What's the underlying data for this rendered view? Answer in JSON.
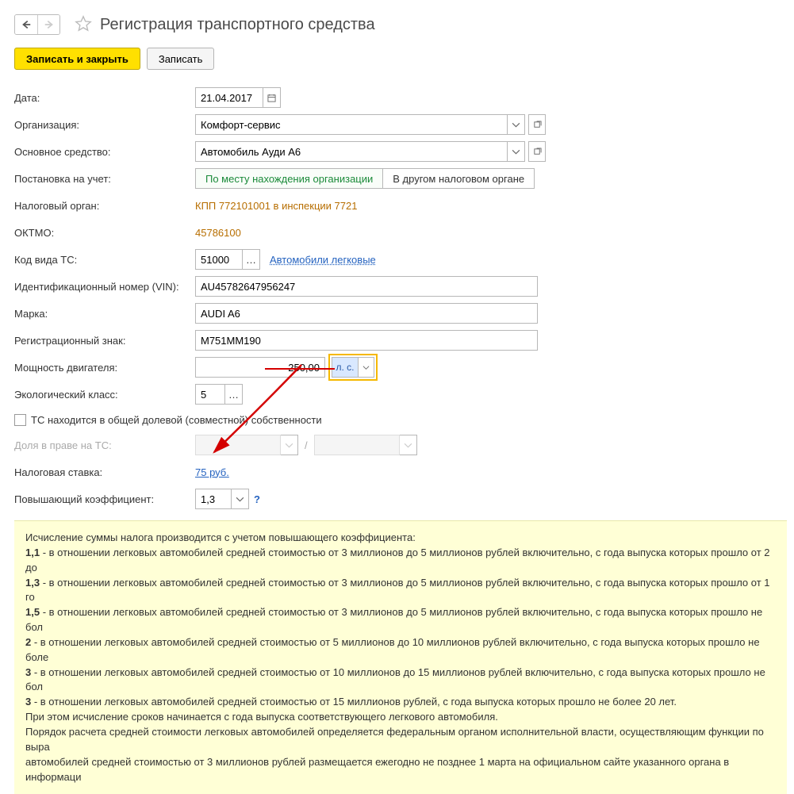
{
  "header": {
    "title": "Регистрация транспортного средства"
  },
  "toolbar": {
    "save_close": "Записать и закрыть",
    "save": "Записать"
  },
  "labels": {
    "date": "Дата:",
    "org": "Организация:",
    "asset": "Основное средство:",
    "registration": "Постановка на учет:",
    "tax_auth": "Налоговый орган:",
    "oktmo": "ОКТМО:",
    "code_ts": "Код вида ТС:",
    "vin": "Идентификационный номер (VIN):",
    "brand": "Марка:",
    "reg_plate": "Регистрационный знак:",
    "power": "Мощность двигателя:",
    "eco": "Экологический класс:",
    "shared": "ТС находится в общей долевой (совместной) собственности",
    "share": "Доля в праве на ТС:",
    "tax_rate": "Налоговая ставка:",
    "coef": "Повышающий коэффициент:"
  },
  "fields": {
    "date": "21.04.2017",
    "org": "Комфорт-сервис",
    "asset": "Автомобиль Ауди A6",
    "reg_opt1": "По месту нахождения организации",
    "reg_opt2": "В другом налоговом органе",
    "tax_auth": "КПП 772101001 в инспекции 7721",
    "oktmo": "45786100",
    "code_ts": "51000",
    "code_ts_desc": "Автомобили легковые",
    "vin": "AU45782647956247",
    "brand": "AUDI A6",
    "reg_plate": "М751ММ190",
    "power": "250,00",
    "power_unit": "л. с.",
    "eco": "5",
    "share_sep": "/",
    "tax_rate": "75 руб.",
    "coef": "1,3"
  },
  "info": {
    "l0": "Исчисление суммы налога производится с учетом повышающего коэффициента:",
    "l1_b": "1,1",
    "l1": " - в отношении легковых автомобилей средней стоимостью от 3 миллионов до 5 миллионов рублей включительно, с года выпуска которых прошло от 2 до",
    "l2_b": "1,3",
    "l2": " - в отношении легковых автомобилей средней стоимостью от 3 миллионов до 5 миллионов рублей включительно, с года выпуска которых прошло от 1 го",
    "l3_b": "1,5",
    "l3": " - в отношении легковых автомобилей средней стоимостью от 3 миллионов до 5 миллионов рублей включительно, с года выпуска которых прошло не бол",
    "l4_b": "2",
    "l4": " - в отношении легковых автомобилей средней стоимостью от 5 миллионов до 10 миллионов рублей включительно, с года выпуска которых прошло не боле",
    "l5_b": "3",
    "l5": " - в отношении легковых автомобилей средней стоимостью от 10 миллионов до 15 миллионов рублей включительно, с года выпуска которых прошло не бол",
    "l6_b": "3",
    "l6": " - в отношении легковых автомобилей средней стоимостью от 15 миллионов рублей, с года выпуска которых прошло не более 20 лет.",
    "l7": "При этом исчисление сроков начинается с года выпуска соответствующего легкового автомобиля.",
    "l8": "Порядок расчета средней стоимости легковых автомобилей определяется федеральным органом исполнительной власти, осуществляющим функции по выра",
    "l9": "автомобилей средней стоимостью от 3 миллионов рублей размещается ежегодно не позднее 1 марта на официальном сайте указанного органа в информаци"
  }
}
